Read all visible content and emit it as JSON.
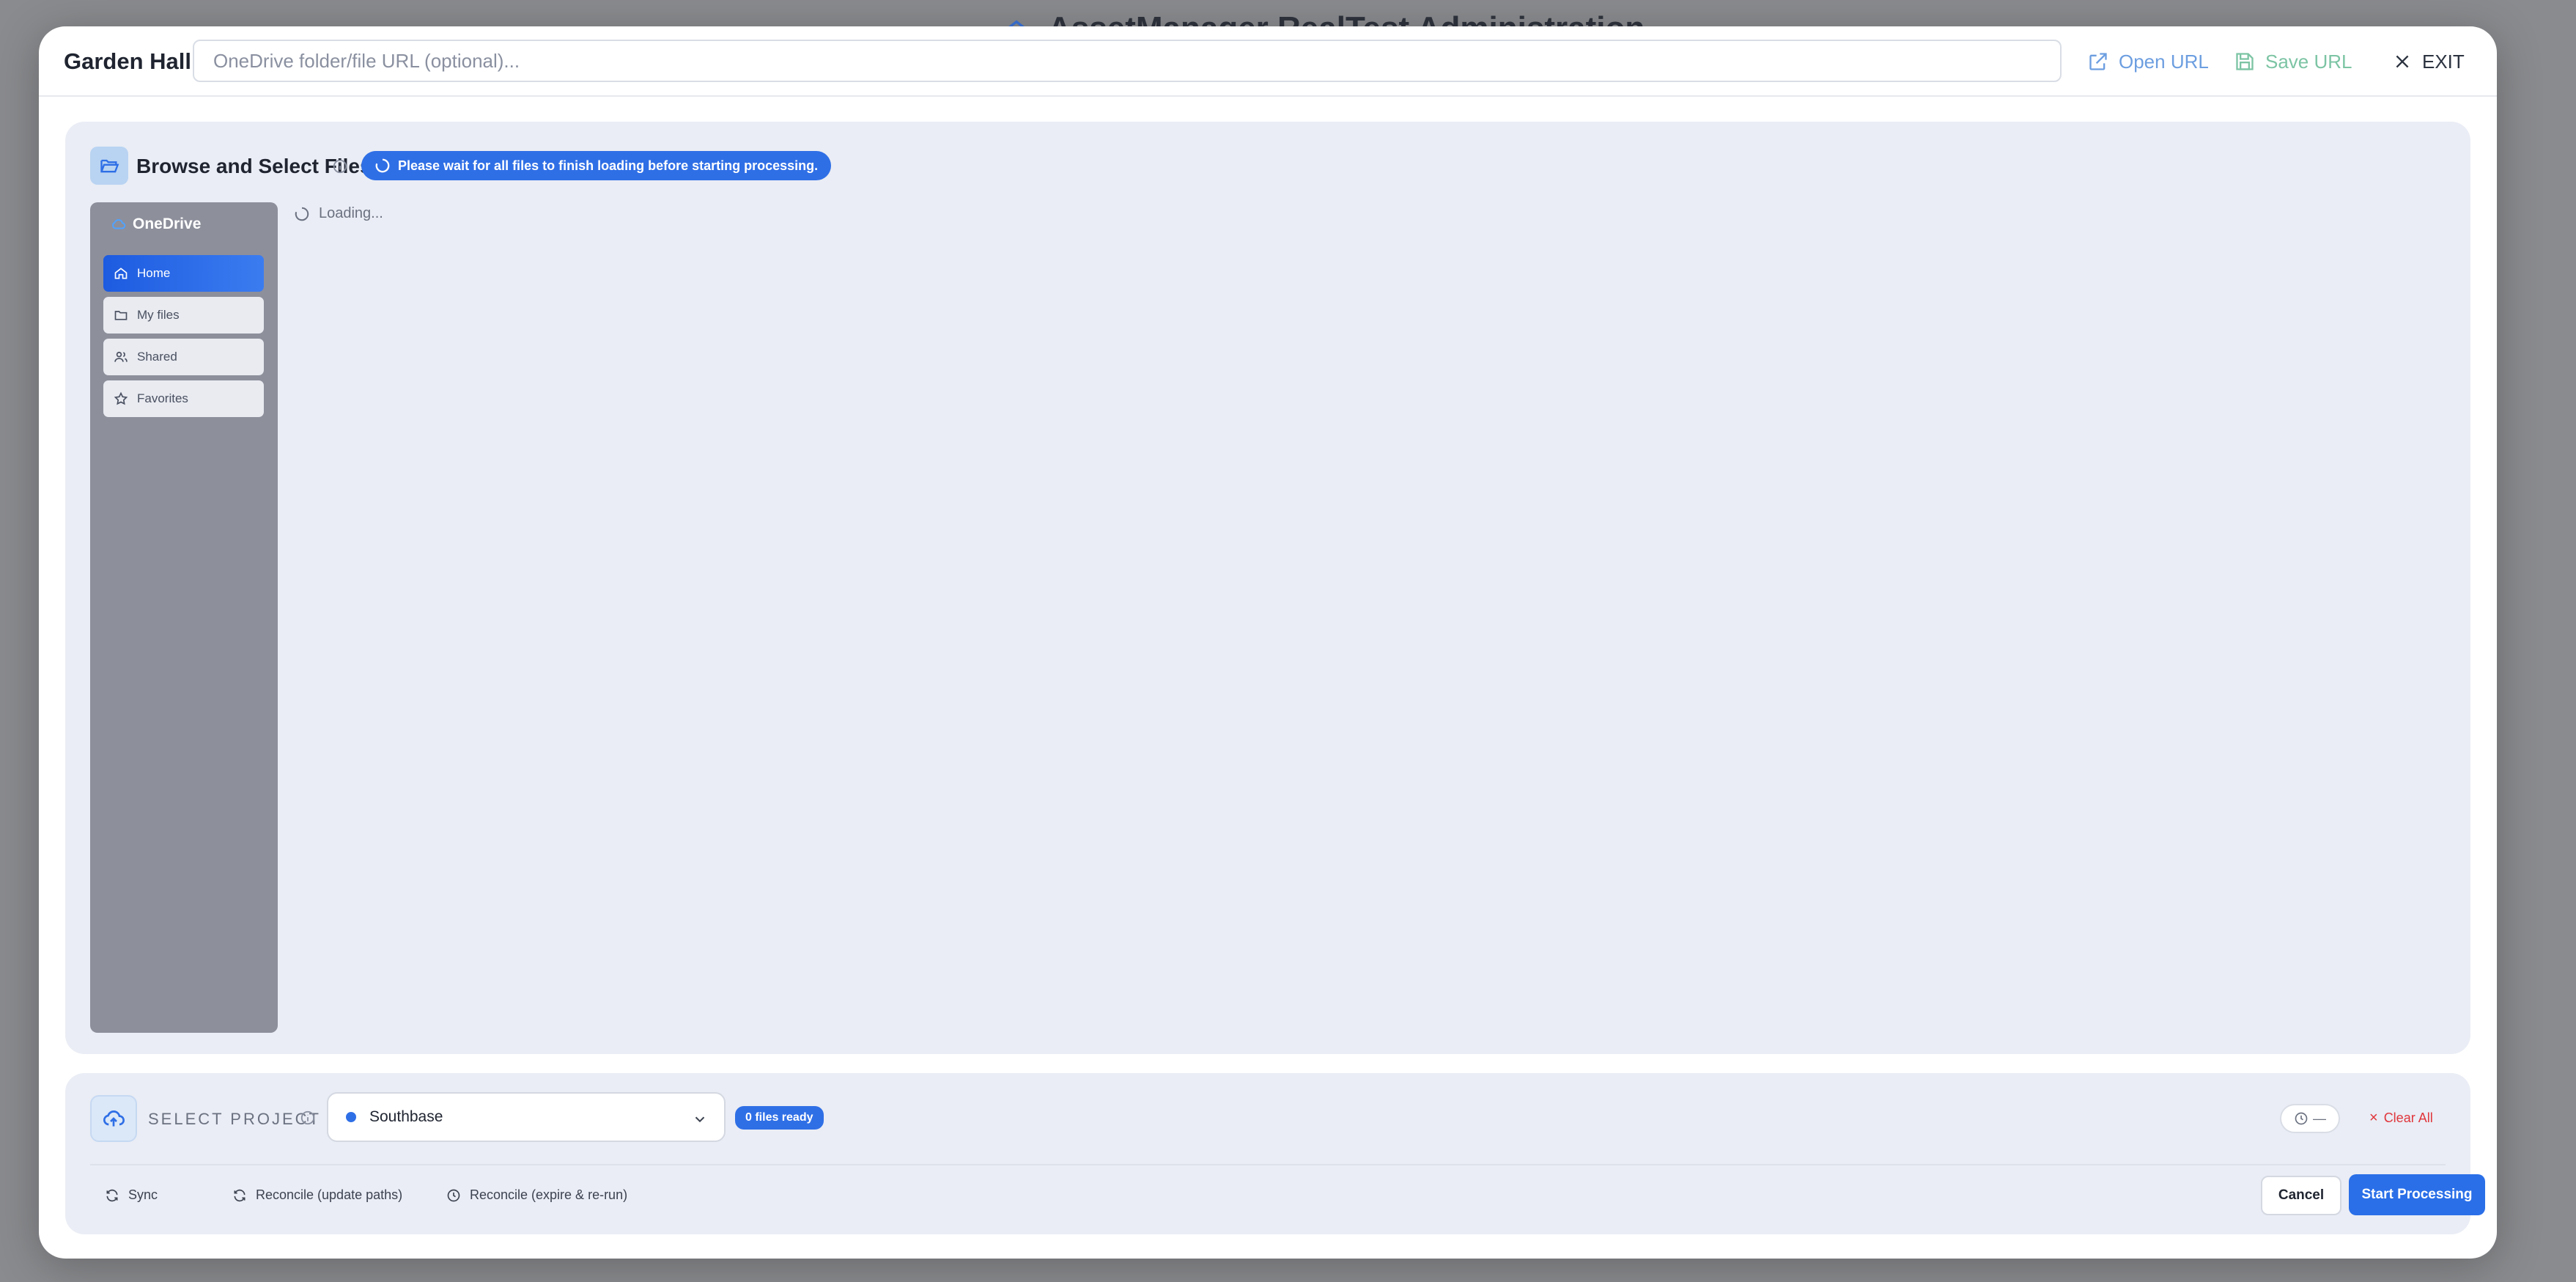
{
  "background": {
    "app_title": "AssetManager RealTest Administration"
  },
  "header": {
    "title": "Garden Hall",
    "url_placeholder": "OneDrive folder/file URL (optional)...",
    "url_value": "",
    "open_url_label": "Open URL",
    "save_url_label": "Save URL",
    "exit_label": "EXIT"
  },
  "browse": {
    "title": "Browse and Select Files",
    "banner": "Please wait for all files to finish loading before starting processing.",
    "loading_text": "Loading...",
    "sidebar": {
      "title": "OneDrive",
      "items": [
        {
          "label": "Home",
          "icon": "home-icon",
          "active": true
        },
        {
          "label": "My files",
          "icon": "folder-icon",
          "active": false
        },
        {
          "label": "Shared",
          "icon": "users-icon",
          "active": false
        },
        {
          "label": "Favorites",
          "icon": "star-icon",
          "active": false
        }
      ]
    }
  },
  "project": {
    "label": "SELECT PROJECT",
    "selected": "Southbase",
    "files_ready": "0 files ready",
    "timer": "—",
    "clear_all": "Clear All"
  },
  "footer": {
    "sync": "Sync",
    "reconcile_update": "Reconcile (update paths)",
    "reconcile_expire": "Reconcile (expire & re-run)",
    "cancel": "Cancel",
    "start": "Start Processing"
  },
  "colors": {
    "accent": "#2f6fe6",
    "danger": "#e0353b",
    "panel": "#eaedf5",
    "sidebar": "#8d8f9b"
  }
}
